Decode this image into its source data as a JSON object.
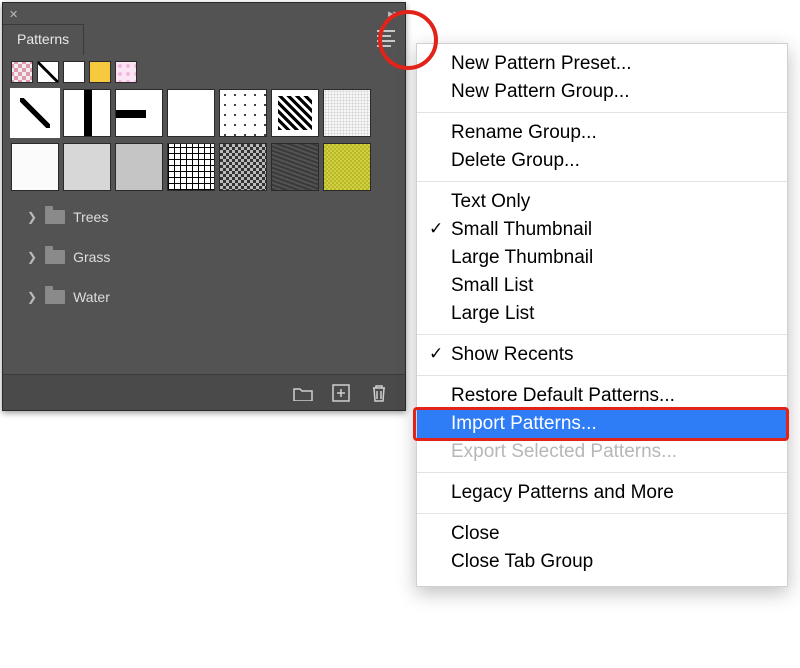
{
  "panel": {
    "title": "Patterns",
    "groups": [
      {
        "label": "Trees"
      },
      {
        "label": "Grass"
      },
      {
        "label": "Water"
      }
    ]
  },
  "menu": {
    "items": [
      {
        "label": "New Pattern Preset...",
        "enabled": true
      },
      {
        "label": "New Pattern Group...",
        "enabled": true
      },
      null,
      {
        "label": "Rename Group...",
        "enabled": true
      },
      {
        "label": "Delete Group...",
        "enabled": true
      },
      null,
      {
        "label": "Text Only",
        "enabled": true
      },
      {
        "label": "Small Thumbnail",
        "enabled": true,
        "checked": true
      },
      {
        "label": "Large Thumbnail",
        "enabled": true
      },
      {
        "label": "Small List",
        "enabled": true
      },
      {
        "label": "Large List",
        "enabled": true
      },
      null,
      {
        "label": "Show Recents",
        "enabled": true,
        "checked": true
      },
      null,
      {
        "label": "Restore Default Patterns...",
        "enabled": true
      },
      {
        "label": "Import Patterns...",
        "enabled": true,
        "selected": true
      },
      {
        "label": "Export Selected Patterns...",
        "enabled": false
      },
      null,
      {
        "label": "Legacy Patterns and More",
        "enabled": true
      },
      null,
      {
        "label": "Close",
        "enabled": true
      },
      {
        "label": "Close Tab Group",
        "enabled": true
      }
    ]
  },
  "annotations": {
    "circle_on": "hamburger-menu-button",
    "box_on": "Import Patterns..."
  }
}
